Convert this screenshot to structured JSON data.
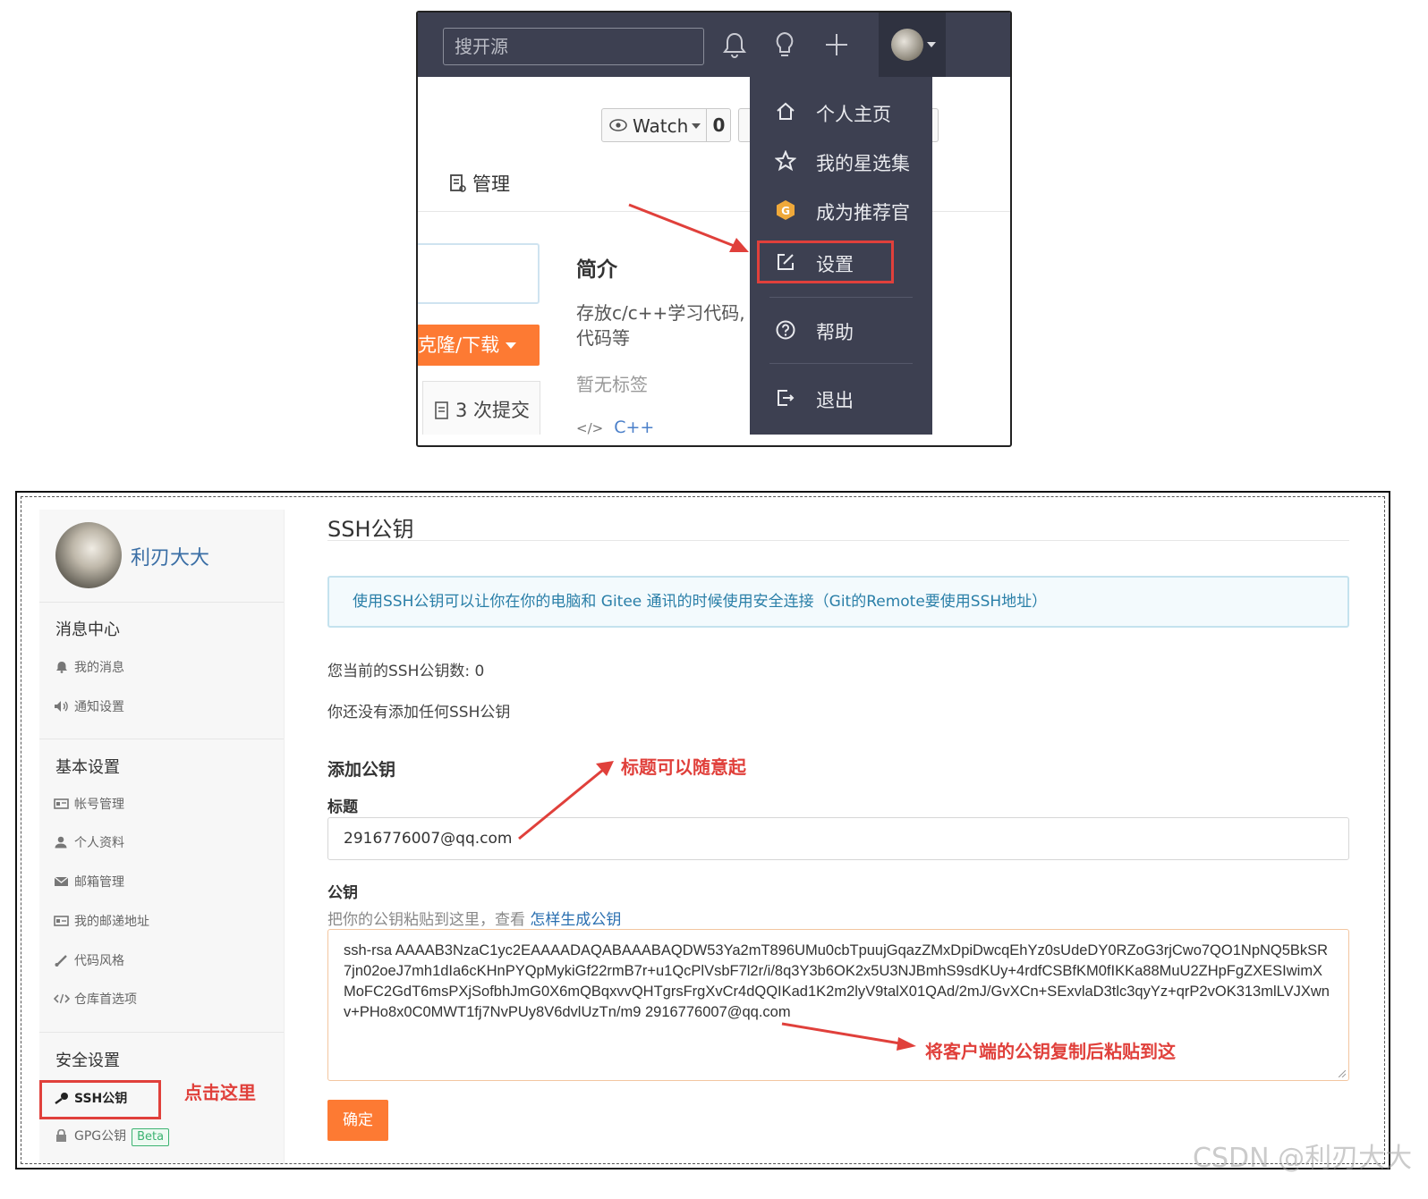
{
  "top": {
    "search_placeholder": "搜开源",
    "watch_label": "Watch",
    "watch_count": "0",
    "manage_tab": "管理",
    "clone_button": "克隆/下载",
    "commits": "3 次提交",
    "intro_title": "简介",
    "intro_desc_line1": "存放c/c++学习代码,",
    "intro_desc_line2": "代码等",
    "no_tags": "暂无标签",
    "language": "C++",
    "menu": {
      "home": "个人主页",
      "stars": "我的星选集",
      "recommender": "成为推荐官",
      "settings": "设置",
      "help": "帮助",
      "logout": "退出"
    }
  },
  "bottom": {
    "username": "利刃大大",
    "sidebar": {
      "messages_section": "消息中心",
      "my_messages": "我的消息",
      "notify_settings": "通知设置",
      "basic_section": "基本设置",
      "account": "帐号管理",
      "profile": "个人资料",
      "email": "邮箱管理",
      "mail_address": "我的邮递地址",
      "code_style": "代码风格",
      "repo_prefs": "仓库首选项",
      "security_section": "安全设置",
      "ssh_keys": "SSH公钥",
      "gpg_keys": "GPG公钥",
      "beta": "Beta"
    },
    "page_title": "SSH公钥",
    "info": "使用SSH公钥可以让你在你的电脑和 Gitee 通讯的时候使用安全连接（Git的Remote要使用SSH地址）",
    "key_count": "您当前的SSH公钥数: 0",
    "no_keys": "你还没有添加任何SSH公钥",
    "add_key": "添加公钥",
    "title_label": "标题",
    "title_value": "2916776007@qq.com",
    "key_label": "公钥",
    "key_hint": "把你的公钥粘贴到这里，查看",
    "key_hint_link": "怎样生成公钥",
    "key_value": "ssh-rsa AAAAB3NzaC1yc2EAAAADAQABAAABAQDW53Ya2mT896UMu0cbTpuujGqazZMxDpiDwcqEhYz0sUdeDY0RZoG3rjCwo7QO1NpNQ5BkSR7jn02oeJ7mh1dIa6cKHnPYQpMykiGf22rmB7r+u1QcPlVsbF7l2r/i/8q3Y3b6OK2x5U3NJBmhS9sdKUy+4rdfCSBfKM0fIKKa88MuU2ZHpFgZXESIwimXMoFC2GdT6msPXjSofbhJmG0X6mQBqxvvQHTgrsFrgXvCr4dQQIKad1K2m2lyV9talX01QAd/2mJ/GvXCn+SExvlaD3tlc3qyYz+qrP2vOK313mlLVJXwnv+PHo8x0C0MWT1fj7NvPUy8V6dvlUzTn/m9 2916776007@qq.com",
    "confirm": "确定",
    "anno_click": "点击这里",
    "anno_title": "标题可以随意起",
    "anno_paste": "将客户端的公钥复制后粘贴到这"
  },
  "watermark": "CSDN @利刃大大",
  "colors": {
    "topbar": "#3d4051",
    "accent_orange": "#fd7a33",
    "annotation_red": "#e0403b",
    "link_blue": "#2a6fb0"
  }
}
